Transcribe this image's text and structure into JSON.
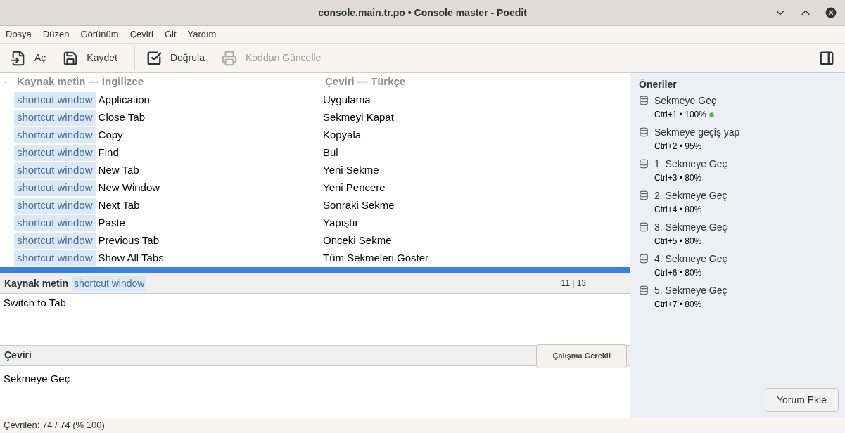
{
  "window": {
    "title": "console.main.tr.po • Console master - Poedit"
  },
  "menu": [
    "Dosya",
    "Düzen",
    "Görünüm",
    "Çeviri",
    "Git",
    "Yardım"
  ],
  "toolbar": [
    {
      "kind": "open",
      "label": "Aç",
      "disabled": false
    },
    {
      "kind": "save",
      "label": "Kaydet",
      "disabled": false
    },
    {
      "kind": "validate",
      "label": "Doğrula",
      "disabled": false
    },
    {
      "kind": "update",
      "label": "Koddan Güncelle",
      "disabled": true
    }
  ],
  "table": {
    "columns": [
      "Kaynak metin — İngilizce",
      "Çeviri — Türkçe"
    ],
    "rows": [
      {
        "context": "shortcut window",
        "source": "Application",
        "translation": "Uygulama",
        "selected": false
      },
      {
        "context": "shortcut window",
        "source": "Close Tab",
        "translation": "Sekmeyi Kapat",
        "selected": false
      },
      {
        "context": "shortcut window",
        "source": "Copy",
        "translation": "Kopyala",
        "selected": false
      },
      {
        "context": "shortcut window",
        "source": "Find",
        "translation": "Bul",
        "selected": false
      },
      {
        "context": "shortcut window",
        "source": "New Tab",
        "translation": "Yeni Sekme",
        "selected": false
      },
      {
        "context": "shortcut window",
        "source": "New Window",
        "translation": "Yeni Pencere",
        "selected": false
      },
      {
        "context": "shortcut window",
        "source": "Next Tab",
        "translation": "Sonraki Sekme",
        "selected": false
      },
      {
        "context": "shortcut window",
        "source": "Paste",
        "translation": "Yapıştır",
        "selected": false
      },
      {
        "context": "shortcut window",
        "source": "Previous Tab",
        "translation": "Önceki Sekme",
        "selected": false
      },
      {
        "context": "shortcut window",
        "source": "Show All Tabs",
        "translation": "Tüm Sekmeleri Göster",
        "selected": false
      },
      {
        "selected": true
      }
    ]
  },
  "source_panel": {
    "title": "Kaynak metin",
    "context": "shortcut window",
    "position": "11 | 13",
    "text": "Switch to Tab"
  },
  "translation_panel": {
    "title": "Çeviri",
    "button": "Çalışma Gerekli",
    "text": "Sekmeye Geç"
  },
  "suggestions": {
    "title": "Öneriler",
    "items": [
      {
        "text": "Sekmeye Geç",
        "meta": "Ctrl+1 • 100%",
        "exact": true
      },
      {
        "text": "Sekmeye geçiş yap",
        "meta": "Ctrl+2 • 95%",
        "exact": false
      },
      {
        "text": "1. Sekmeye Geç",
        "meta": "Ctrl+3 • 80%",
        "exact": false
      },
      {
        "text": "2. Sekmeye Geç",
        "meta": "Ctrl+4 • 80%",
        "exact": false
      },
      {
        "text": "3. Sekmeye Geç",
        "meta": "Ctrl+5 • 80%",
        "exact": false
      },
      {
        "text": "4. Sekmeye Geç",
        "meta": "Ctrl+6 • 80%",
        "exact": false
      },
      {
        "text": "5. Sekmeye Geç",
        "meta": "Ctrl+7 • 80%",
        "exact": false
      }
    ],
    "button": "Yorum Ekle"
  },
  "status_bar": "Çevrilen: 74 / 74 (% 100)"
}
